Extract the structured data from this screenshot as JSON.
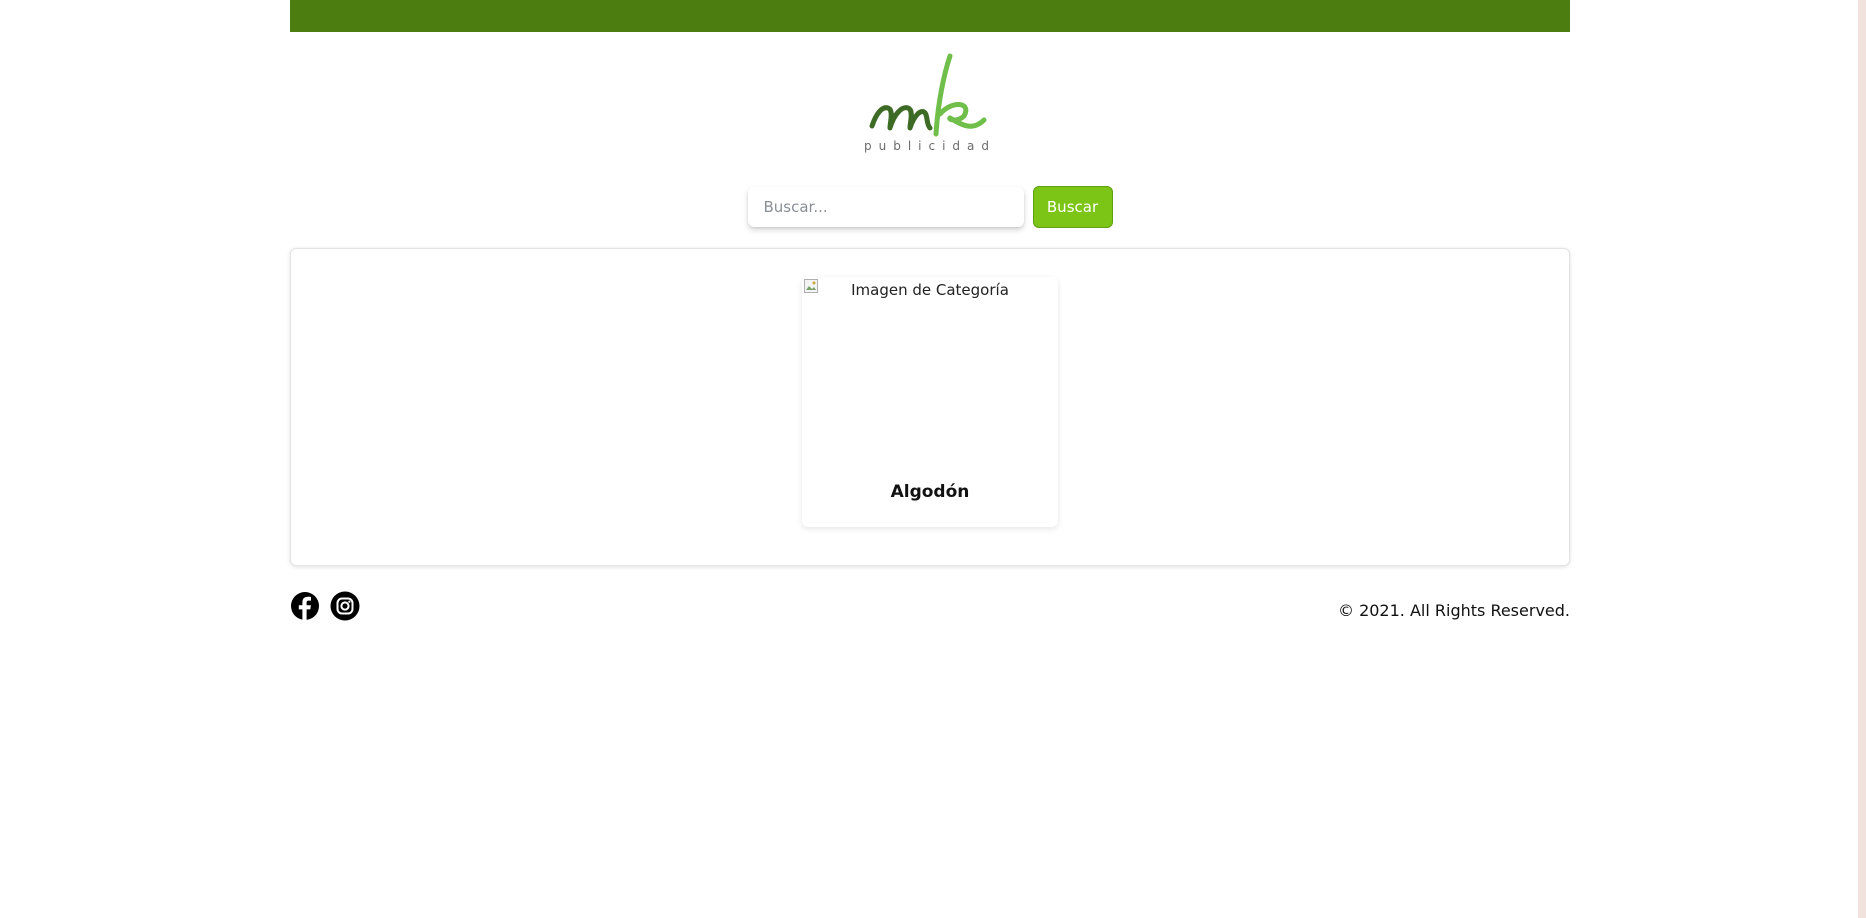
{
  "header": {
    "brand_mark": "mk",
    "brand_tagline": "publicidad",
    "colors": {
      "top_bar": "#4b7d10",
      "accent": "#7cc516",
      "logo_dark": "#3d6b25",
      "logo_light": "#6fbf4a"
    }
  },
  "search": {
    "placeholder": "Buscar...",
    "value": "",
    "button_label": "Buscar"
  },
  "categories": [
    {
      "image_alt": "Imagen de Categoría",
      "name": "Algodón"
    }
  ],
  "footer": {
    "social": [
      {
        "name": "facebook",
        "icon": "facebook-icon"
      },
      {
        "name": "instagram",
        "icon": "instagram-icon"
      }
    ],
    "copyright": "© 2021. All Rights Reserved."
  }
}
